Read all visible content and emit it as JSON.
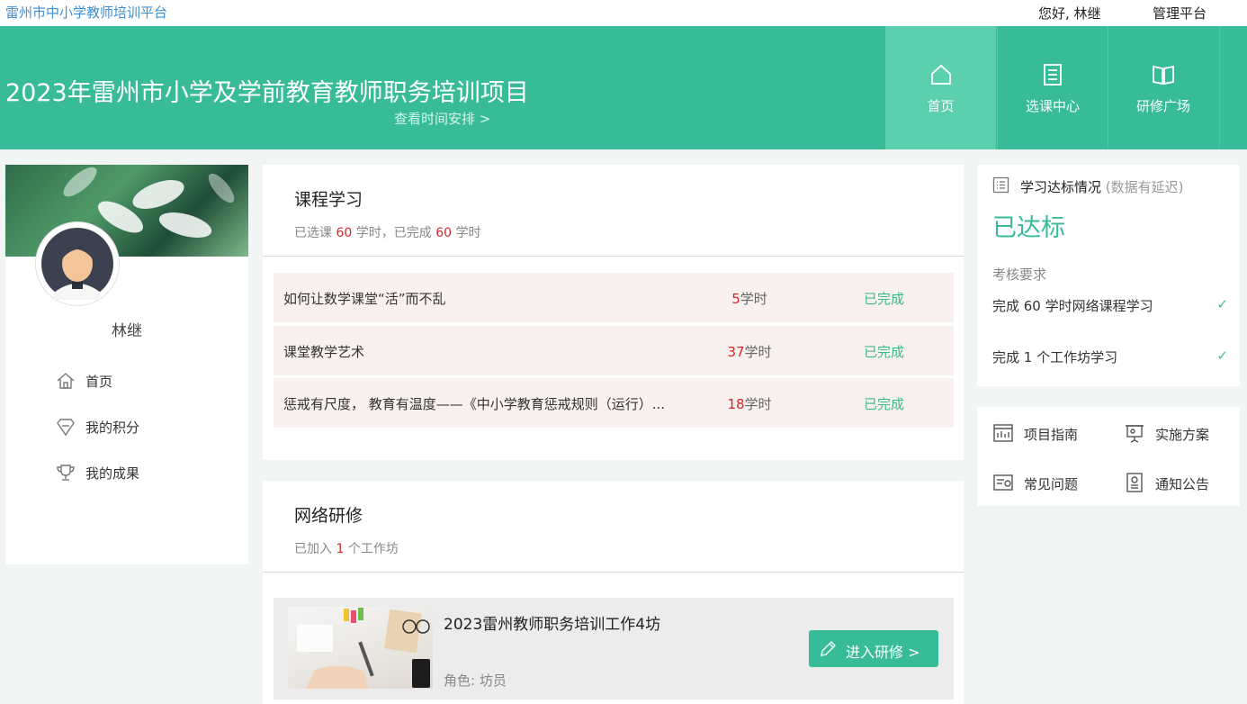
{
  "topbar": {
    "site_name": "雷州市中小学教师培训平台",
    "greeting": "您好, 林继",
    "admin": "管理平台"
  },
  "banner": {
    "title": "2023年雷州市小学及学前教育教师职务培训项目",
    "schedule_link": "查看时间安排 >"
  },
  "nav": [
    {
      "label": "首页",
      "icon": "home-icon",
      "active": true
    },
    {
      "label": "选课中心",
      "icon": "document-icon",
      "active": false
    },
    {
      "label": "研修广场",
      "icon": "book-icon",
      "active": false
    }
  ],
  "profile": {
    "name": "林继",
    "menu": [
      {
        "label": "首页",
        "icon": "home-icon"
      },
      {
        "label": "我的积分",
        "icon": "points-icon"
      },
      {
        "label": "我的成果",
        "icon": "trophy-icon"
      }
    ]
  },
  "course_study": {
    "title": "课程学习",
    "sub_prefix": "已选课",
    "selected_hours": "60",
    "sub_mid": "学时，已完成",
    "completed_hours": "60",
    "sub_suffix": "学时",
    "rows": [
      {
        "name": "如何让数学课堂“活”而不乱",
        "hours": "5",
        "unit": "学时",
        "status": "已完成"
      },
      {
        "name": "课堂教学艺术",
        "hours": "37",
        "unit": "学时",
        "status": "已完成"
      },
      {
        "name": "惩戒有尺度， 教育有温度——《中小学教育惩戒规则（运行）...",
        "hours": "18",
        "unit": "学时",
        "status": "已完成"
      }
    ]
  },
  "online_study": {
    "title": "网络研修",
    "sub_prefix": "已加入",
    "count": "1",
    "sub_suffix": "个工作坊",
    "workshop": {
      "name": "2023雷州教师职务培训工作4坊",
      "role": "角色: 坊员",
      "button": "进入研修 >"
    }
  },
  "status": {
    "heading": "学习达标情况",
    "heading_note": "(数据有延迟)",
    "value": "已达标",
    "requirements_label": "考核要求",
    "requirements": [
      {
        "text": "完成 60 学时网络课程学习",
        "check": "✓"
      },
      {
        "text": "完成 1 个工作坊学习",
        "check": "✓"
      }
    ]
  },
  "links": [
    {
      "label": "项目指南",
      "icon": "guide-icon"
    },
    {
      "label": "实施方案",
      "icon": "presentation-icon"
    },
    {
      "label": "常见问题",
      "icon": "faq-icon"
    },
    {
      "label": "通知公告",
      "icon": "notice-icon"
    }
  ],
  "colors": {
    "brand": "#38bc98",
    "nav_active": "#5ccfaf",
    "highlight_red": "#d6262a",
    "site_link": "#3b8fd6"
  }
}
